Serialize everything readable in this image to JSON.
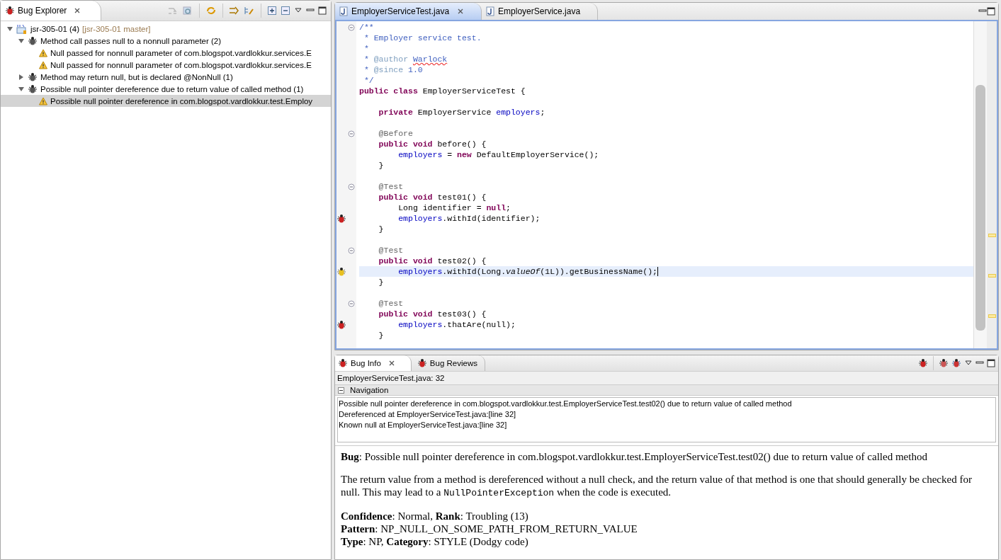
{
  "bug_explorer": {
    "title": "Bug Explorer",
    "tree": [
      {
        "label": "jsr-305-01 (4)",
        "suffix": "[jsr-305-01 master]",
        "kind": "project",
        "expanded": true,
        "selected": false,
        "children": [
          {
            "label": "Method call passes null to a nonnull parameter  (2)",
            "kind": "category",
            "expanded": true,
            "selected": false,
            "children": [
              {
                "label": "Null passed for nonnull parameter of com.blogspot.vardlokkur.services.E",
                "kind": "warning",
                "selected": false
              },
              {
                "label": "Null passed for nonnull parameter of com.blogspot.vardlokkur.services.E",
                "kind": "warning",
                "selected": false
              }
            ]
          },
          {
            "label": "Method may return null, but is declared @NonNull (1)",
            "kind": "category",
            "expanded": false,
            "selected": false
          },
          {
            "label": "Possible null pointer dereference due to return value of called method (1)",
            "kind": "category",
            "expanded": true,
            "selected": false,
            "children": [
              {
                "label": "Possible null pointer dereference in com.blogspot.vardlokkur.test.Employ",
                "kind": "warning",
                "selected": true
              }
            ]
          }
        ]
      }
    ]
  },
  "editor": {
    "tabs": [
      {
        "label": "EmployerServiceTest.java",
        "selected": true,
        "closable": true
      },
      {
        "label": "EmployerService.java",
        "selected": false,
        "closable": false
      }
    ],
    "code_lines": [
      {
        "kind": "code",
        "fold": true,
        "bug": false,
        "current": false,
        "tokens": [
          {
            "text": "/**",
            "kind": "doc"
          }
        ]
      },
      {
        "kind": "code",
        "fold": false,
        "bug": false,
        "current": false,
        "tokens": [
          {
            "text": " * Employer service test.",
            "kind": "doc"
          }
        ]
      },
      {
        "kind": "code",
        "fold": false,
        "bug": false,
        "current": false,
        "tokens": [
          {
            "text": " *",
            "kind": "doc"
          }
        ]
      },
      {
        "kind": "code",
        "fold": false,
        "bug": false,
        "current": false,
        "tokens": [
          {
            "text": " * ",
            "kind": "doc"
          },
          {
            "text": "@author",
            "kind": "doctag"
          },
          {
            "text": "Warlock",
            "kind": "spell"
          }
        ]
      },
      {
        "kind": "code",
        "fold": false,
        "bug": false,
        "current": false,
        "tokens": [
          {
            "text": " * ",
            "kind": "doc"
          },
          {
            "text": "@since",
            "kind": "doctag"
          },
          {
            "text": " 1.0",
            "kind": "doc"
          }
        ]
      },
      {
        "kind": "code",
        "fold": false,
        "bug": false,
        "current": false,
        "tokens": [
          {
            "text": " */",
            "kind": "doc"
          }
        ]
      },
      {
        "kind": "code",
        "fold": false,
        "bug": false,
        "current": false,
        "tokens": [
          {
            "text": "public class",
            "kind": "kw"
          },
          {
            "text": " EmployerServiceTest {",
            "kind": "plain"
          }
        ]
      },
      {
        "kind": "blank"
      },
      {
        "kind": "code",
        "fold": false,
        "bug": false,
        "current": false,
        "tokens": [
          {
            "text": "    private",
            "kind": "kw"
          },
          {
            "text": " EmployerService ",
            "kind": "plain"
          },
          {
            "text": "employers",
            "kind": "field"
          },
          {
            "text": ";",
            "kind": "plain"
          }
        ]
      },
      {
        "kind": "blank"
      },
      {
        "kind": "code",
        "fold": true,
        "bug": false,
        "current": false,
        "tokens": [
          {
            "text": "    @Before",
            "kind": "ann"
          }
        ]
      },
      {
        "kind": "code",
        "fold": false,
        "bug": false,
        "current": false,
        "tokens": [
          {
            "text": "    public void",
            "kind": "kw"
          },
          {
            "text": " before() {",
            "kind": "plain"
          }
        ]
      },
      {
        "kind": "code",
        "fold": false,
        "bug": false,
        "current": false,
        "tokens": [
          {
            "text": "        employers",
            "kind": "field"
          },
          {
            "text": " = ",
            "kind": "plain"
          },
          {
            "text": "new",
            "kind": "kw"
          },
          {
            "text": " DefaultEmployerService();",
            "kind": "plain"
          }
        ]
      },
      {
        "kind": "code",
        "fold": false,
        "bug": false,
        "current": false,
        "tokens": [
          {
            "text": "    }",
            "kind": "plain"
          }
        ]
      },
      {
        "kind": "blank"
      },
      {
        "kind": "code",
        "fold": true,
        "bug": false,
        "current": false,
        "tokens": [
          {
            "text": "    @Test",
            "kind": "ann"
          }
        ]
      },
      {
        "kind": "code",
        "fold": false,
        "bug": false,
        "current": false,
        "tokens": [
          {
            "text": "    public void",
            "kind": "kw"
          },
          {
            "text": " test01() {",
            "kind": "plain"
          }
        ]
      },
      {
        "kind": "code",
        "fold": false,
        "bug": false,
        "current": false,
        "tokens": [
          {
            "text": "        Long identifier = ",
            "kind": "plain"
          },
          {
            "text": "null",
            "kind": "kw"
          },
          {
            "text": ";",
            "kind": "plain"
          }
        ]
      },
      {
        "kind": "code",
        "fold": false,
        "bug": true,
        "current": false,
        "tokens": [
          {
            "text": "        employers",
            "kind": "field"
          },
          {
            "text": ".withId(identifier);",
            "kind": "plain"
          }
        ]
      },
      {
        "kind": "code",
        "fold": false,
        "bug": false,
        "current": false,
        "tokens": [
          {
            "text": "    }",
            "kind": "plain"
          }
        ]
      },
      {
        "kind": "blank"
      },
      {
        "kind": "code",
        "fold": true,
        "bug": false,
        "current": false,
        "tokens": [
          {
            "text": "    @Test",
            "kind": "ann"
          }
        ]
      },
      {
        "kind": "code",
        "fold": false,
        "bug": false,
        "current": false,
        "tokens": [
          {
            "text": "    public void",
            "kind": "kw"
          },
          {
            "text": " test02() {",
            "kind": "plain"
          }
        ]
      },
      {
        "kind": "code",
        "fold": false,
        "bug": true,
        "current": true,
        "tokens": [
          {
            "text": "        employers",
            "kind": "field"
          },
          {
            "text": ".withId(Long.",
            "kind": "plain"
          },
          {
            "text": "valueOf",
            "kind": "static"
          },
          {
            "text": "(1L)).getBusinessName();",
            "kind": "plain"
          }
        ]
      },
      {
        "kind": "code",
        "fold": false,
        "bug": false,
        "current": false,
        "tokens": [
          {
            "text": "    }",
            "kind": "plain"
          }
        ]
      },
      {
        "kind": "blank"
      },
      {
        "kind": "code",
        "fold": true,
        "bug": false,
        "current": false,
        "tokens": [
          {
            "text": "    @Test",
            "kind": "ann"
          }
        ]
      },
      {
        "kind": "code",
        "fold": false,
        "bug": false,
        "current": false,
        "tokens": [
          {
            "text": "    public void",
            "kind": "kw"
          },
          {
            "text": " test03() {",
            "kind": "plain"
          }
        ]
      },
      {
        "kind": "code",
        "fold": false,
        "bug": true,
        "current": false,
        "tokens": [
          {
            "text": "        employers",
            "kind": "field"
          },
          {
            "text": ".thatAre(null);",
            "kind": "plain"
          }
        ]
      },
      {
        "kind": "code",
        "fold": false,
        "bug": false,
        "current": false,
        "tokens": [
          {
            "text": "    }",
            "kind": "plain"
          }
        ]
      }
    ]
  },
  "bug_info": {
    "tabs": [
      {
        "label": "Bug Info",
        "selected": true,
        "closable": true
      },
      {
        "label": "Bug Reviews",
        "selected": false,
        "closable": false
      }
    ],
    "location": "EmployerServiceTest.java: 32",
    "navigation": {
      "title": "Navigation",
      "expanded": true,
      "lines": [
        "Possible null pointer dereference in com.blogspot.vardlokkur.test.EmployerServiceTest.test02() due to return value of called method",
        "Dereferenced at EmployerServiceTest.java:[line 32]",
        "Known null at EmployerServiceTest.java:[line 32]"
      ]
    },
    "summary": "**Bug**: Possible null pointer dereference in com.blogspot.vardlokkur.test.EmployerServiceTest.test02() due to return value of called method",
    "description": [
      {
        "text": "The return value from a method is dereferenced without a null check, and the return value of that method is one that should generally be checked for null. This may lead to a ",
        "kind": "text"
      },
      {
        "text": "NullPointerException",
        "kind": "code"
      },
      {
        "text": " when the code is executed.",
        "kind": "text"
      }
    ],
    "details": [
      "**Confidence**: Normal, **Rank**: Troubling (13)",
      "**Pattern**: NP_NULL_ON_SOME_PATH_FROM_RETURN_VALUE",
      "**Type**: NP, **Category**: STYLE (Dodgy code)"
    ]
  }
}
